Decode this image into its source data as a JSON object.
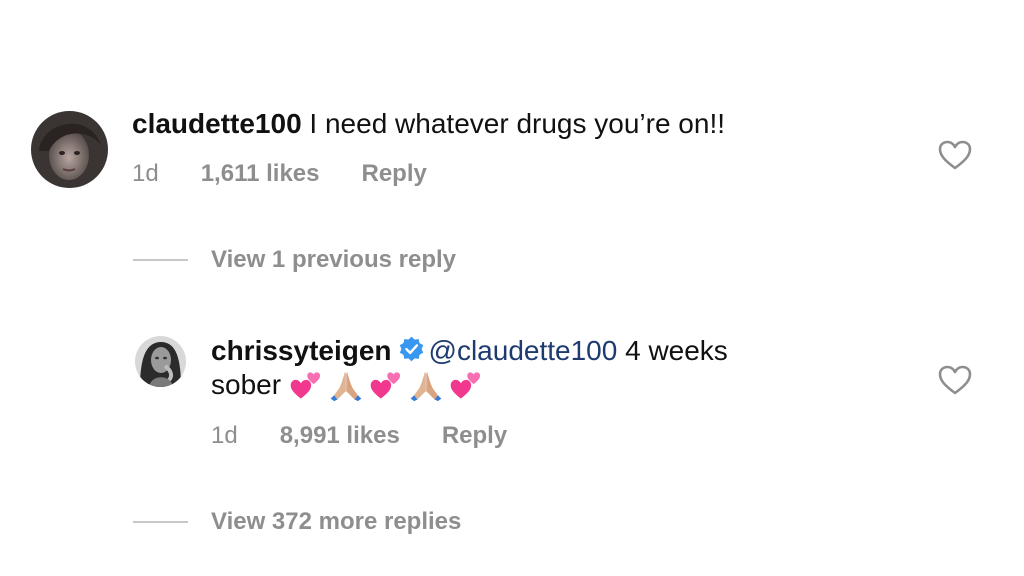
{
  "comments": [
    {
      "username": "claudette100",
      "text": "I need whatever drugs you’re on!!",
      "time": "1d",
      "likes": "1,611 likes",
      "reply_label": "Reply"
    },
    {
      "username": "chrissyteigen",
      "mention": "@claudette100",
      "text_line1_rest": "4 weeks",
      "text_line2": "sober",
      "emojis": [
        "two-hearts",
        "folded-hands",
        "two-hearts",
        "folded-hands",
        "two-hearts"
      ],
      "time": "1d",
      "likes": "8,991 likes",
      "reply_label": "Reply"
    }
  ],
  "view_previous_replies": "View 1 previous reply",
  "view_more_replies": "View 372 more replies",
  "colors": {
    "text": "#111111",
    "meta": "#8e8e8e",
    "mention": "#1e3a70",
    "verified": "#3897f0",
    "heart_outline": "#8e8e8e"
  },
  "icons": [
    "heart-outline-icon",
    "verified-badge-icon"
  ]
}
